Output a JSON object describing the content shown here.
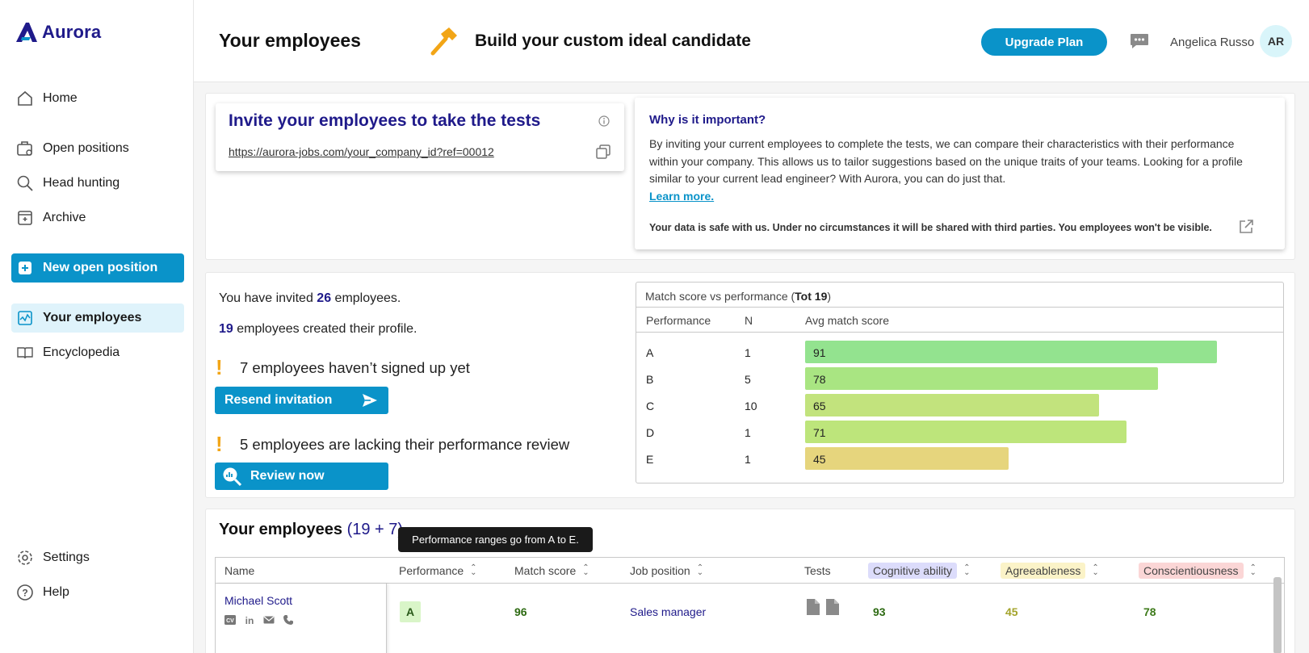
{
  "app": {
    "logo_text": "Aurora",
    "brand_color": "#1f1a8a",
    "accent_color": "#0a93c9"
  },
  "sidebar": {
    "items": [
      {
        "label": "Home",
        "icon": "home-icon"
      },
      {
        "label": "Open positions",
        "icon": "briefcase-icon"
      },
      {
        "label": "Head hunting",
        "icon": "search-icon"
      },
      {
        "label": "Archive",
        "icon": "archive-icon"
      },
      {
        "label": "New open position",
        "icon": "plus-icon"
      },
      {
        "label": "Your employees",
        "icon": "chart-icon"
      },
      {
        "label": "Encyclopedia",
        "icon": "book-icon"
      },
      {
        "label": "Settings",
        "icon": "gear-icon"
      },
      {
        "label": "Help",
        "icon": "help-icon"
      }
    ]
  },
  "header": {
    "title": "Your employees",
    "builder_label": "Build your custom ideal candidate",
    "upgrade_label": "Upgrade Plan",
    "user_name": "Angelica Russo",
    "user_initials": "AR"
  },
  "invite": {
    "title": "Invite your employees to take the tests",
    "link": "https://aurora-jobs.com/your_company_id?ref=00012"
  },
  "why": {
    "title": "Why is it important?",
    "body": "By inviting your current employees to complete the tests, we can compare their characteristics with their performance within your company. This allows us to tailor suggestions based on the unique traits of your teams. Looking for a profile similar to your current lead engineer? With Aurora, you can do just that.",
    "learn_more": "Learn more.",
    "safe_note": "Your data is safe with us. Under no circumstances it will be shared with third parties. You employees won't be visible."
  },
  "stats": {
    "invited_pre": "You have invited",
    "invited_count": "26",
    "invited_post": "employees.",
    "created_count": "19",
    "created_post": "employees created their profile.",
    "not_signed": "7 employees haven’t signed up yet",
    "resend_label": "Resend invitation",
    "lacking_review": "5 employees are lacking their performance review",
    "review_label": "Review now"
  },
  "score_table": {
    "title_pre": "Match score vs performance (",
    "title_total": "Tot 19",
    "title_post": ")",
    "columns": [
      "Performance",
      "N",
      "Avg match score"
    ],
    "rows": [
      {
        "performance": "A",
        "n": "1",
        "avg": 91,
        "color": "#93e38f"
      },
      {
        "performance": "B",
        "n": "5",
        "avg": 78,
        "color": "#a9e582"
      },
      {
        "performance": "C",
        "n": "10",
        "avg": 65,
        "color": "#c2e37d"
      },
      {
        "performance": "D",
        "n": "1",
        "avg": 71,
        "color": "#bde57b"
      },
      {
        "performance": "E",
        "n": "1",
        "avg": 45,
        "color": "#e6d57d"
      }
    ]
  },
  "employees": {
    "title": "Your employees",
    "count_label": "(19 + 7)",
    "tooltip": "Performance ranges go from A to E.",
    "columns": {
      "name": "Name",
      "performance": "Performance",
      "match": "Match score",
      "job": "Job position",
      "tests": "Tests",
      "cognitive": "Cognitive ability",
      "agreeableness": "Agreeableness",
      "conscientiousness": "Conscientiousness"
    },
    "trait_colors": {
      "cognitive": "#dcdcfb",
      "agreeableness": "#fbf3c8",
      "conscientiousness": "#fbd6d6"
    },
    "rows": [
      {
        "name": "Michael Scott",
        "performance": "A",
        "match": "96",
        "job": "Sales manager",
        "cognitive": "93",
        "agreeableness": "45",
        "conscientiousness": "78"
      }
    ]
  }
}
